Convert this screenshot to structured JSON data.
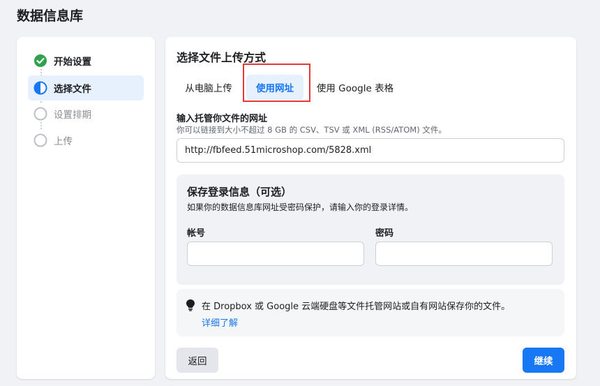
{
  "page": {
    "title": "数据信息库"
  },
  "steps": [
    {
      "label": "开始设置",
      "state": "done",
      "icon": "check-circle-icon"
    },
    {
      "label": "选择文件",
      "state": "active",
      "icon": "half-circle-icon"
    },
    {
      "label": "设置排期",
      "state": "pending",
      "icon": "empty-circle-icon"
    },
    {
      "label": "上传",
      "state": "pending",
      "icon": "empty-circle-icon"
    }
  ],
  "upload": {
    "title": "选择文件上传方式",
    "tabs": [
      {
        "label": "从电脑上传",
        "selected": false
      },
      {
        "label": "使用网址",
        "selected": true
      },
      {
        "label": "使用 Google 表格",
        "selected": false
      }
    ]
  },
  "url_field": {
    "label": "输入托管你文件的网址",
    "help": "你可以链接到大小不超过 8 GB 的 CSV、TSV 或 XML (RSS/ATOM) 文件。",
    "value": "http://fbfeed.51microshop.com/5828.xml"
  },
  "login": {
    "title": "保存登录信息（可选）",
    "description": "如果你的数据信息库网址受密码保护，请输入你的登录详情。",
    "username_label": "帐号",
    "username_value": "",
    "password_label": "密码",
    "password_value": ""
  },
  "tip": {
    "icon": "lightbulb-icon",
    "text": "在 Dropbox 或 Google 云端硬盘等文件托管网站或自有网站保存你的文件。",
    "link": "详细了解"
  },
  "buttons": {
    "back": "返回",
    "continue": "继续"
  },
  "colors": {
    "accent": "#1877f2",
    "success": "#31a24c",
    "highlight": "#e53935"
  }
}
